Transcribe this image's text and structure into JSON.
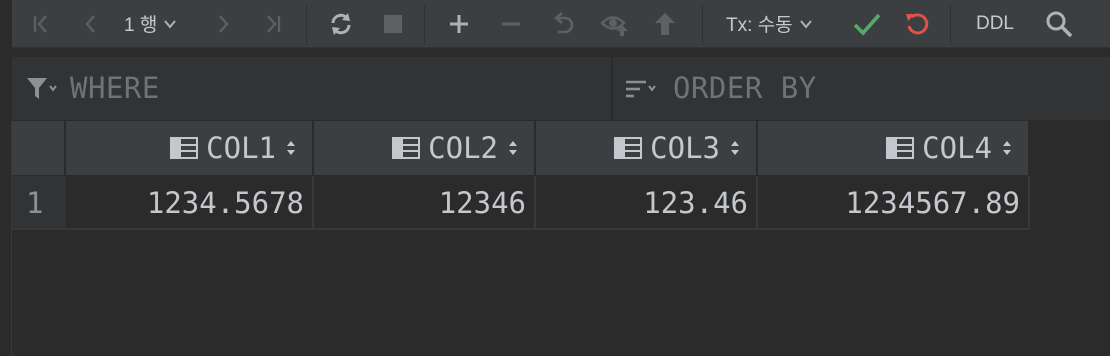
{
  "toolbar": {
    "row_selector": "1 행",
    "tx_mode": "Tx: 수동",
    "ddl_label": "DDL"
  },
  "filter": {
    "where_label": "WHERE",
    "order_by_label": "ORDER BY"
  },
  "grid": {
    "columns": [
      "COL1",
      "COL2",
      "COL3",
      "COL4"
    ],
    "rows": [
      {
        "row_number": "1",
        "cells": [
          "1234.5678",
          "12346",
          "123.46",
          "1234567.89"
        ]
      }
    ]
  },
  "colors": {
    "commit_green": "#59a869",
    "rollback_red": "#e0524a",
    "icon_dim": "#5e6163",
    "icon_active": "#afb1b3"
  }
}
